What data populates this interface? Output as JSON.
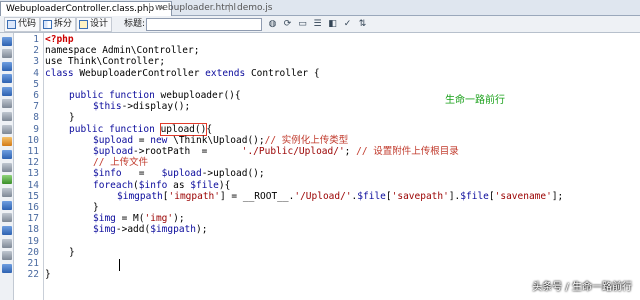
{
  "tabs": [
    {
      "label": "WebuploaderController.class.php",
      "active": true
    },
    {
      "label": "webuploader.html",
      "active": false
    },
    {
      "label": "demo.js",
      "active": false
    }
  ],
  "toolbar": {
    "code_label": "代码",
    "split_label": "拆分",
    "design_label": "设计",
    "title_label": "标题:",
    "title_value": ""
  },
  "gutter": {
    "line_numbers": [
      "1",
      "2",
      "3",
      "4",
      "5",
      "6",
      "7",
      "8",
      "9",
      "10",
      "11",
      "12",
      "13",
      "14",
      "15",
      "16",
      "17",
      "18",
      "19",
      "20",
      "21",
      "22"
    ]
  },
  "code": {
    "l1": "<?php",
    "l2": "namespace Admin\\Controller;",
    "l3": "use Think\\Controller;",
    "l4a": "class",
    "l4b": " WebuploaderController ",
    "l4c": "extends",
    "l4d": " Controller {",
    "l6a": "public",
    "l6b": " ",
    "l6c": "function",
    "l6d": " webuploader(){",
    "l7a": "$this",
    "l7b": "->display();",
    "l8": "}",
    "l9a": "public",
    "l9b": " ",
    "l9c": "function",
    "l9d": " ",
    "l9e": "upload()",
    "l9f": "{",
    "l10a": "$upload",
    "l10b": " = ",
    "l10c": "new",
    "l10d": " \\Think\\Upload();",
    "l10e": "// 实例化上传类型",
    "l11a": "$upload",
    "l11b": "->rootPath  =      ",
    "l11c": "'./Public/Upload/'",
    "l11d": "; ",
    "l11e": "// 设置附件上传根目录",
    "l12": "// 上传文件",
    "l13a": "$info",
    "l13b": "   =   ",
    "l13c": "$upload",
    "l13d": "->upload();",
    "l14a": "foreach",
    "l14b": "(",
    "l14c": "$info",
    "l14d": " as ",
    "l14e": "$file",
    "l14f": "){",
    "l15a": "$imgpath",
    "l15b": "[",
    "l15c": "'imgpath'",
    "l15d": "] = __ROOT__.",
    "l15e": "'/Upload/'",
    "l15f": ".",
    "l15g": "$file",
    "l15h": "[",
    "l15i": "'savepath'",
    "l15j": "].",
    "l15k": "$file",
    "l15l": "[",
    "l15m": "'savename'",
    "l15n": "];",
    "l16": "}",
    "l17a": "$img",
    "l17b": " = M(",
    "l17c": "'img'",
    "l17d": ");",
    "l18a": "$img",
    "l18b": "->add(",
    "l18c": "$imgpath",
    "l18d": ");",
    "l20": "}",
    "l22": "}"
  },
  "annotation": "生命一路前行",
  "watermark": "头条号 / 生命一路前行"
}
